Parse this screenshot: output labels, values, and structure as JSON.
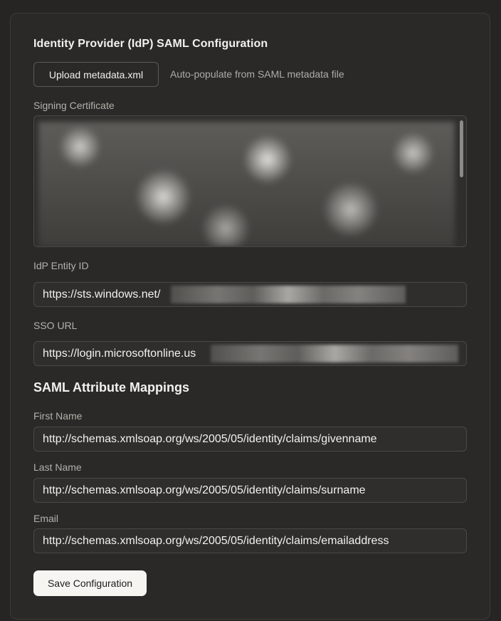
{
  "idp": {
    "title": "Identity Provider (IdP) SAML Configuration",
    "upload_label": "Upload metadata.xml",
    "upload_hint": "Auto-populate from SAML metadata file",
    "cert_label": "Signing Certificate",
    "entity_label": "IdP Entity ID",
    "entity_value": "https://sts.windows.net/",
    "sso_label": "SSO URL",
    "sso_value": "https://login.microsoftonline.us"
  },
  "mappings": {
    "title": "SAML Attribute Mappings",
    "first_name_label": "First Name",
    "first_name_value": "http://schemas.xmlsoap.org/ws/2005/05/identity/claims/givenname",
    "last_name_label": "Last Name",
    "last_name_value": "http://schemas.xmlsoap.org/ws/2005/05/identity/claims/surname",
    "email_label": "Email",
    "email_value": "http://schemas.xmlsoap.org/ws/2005/05/identity/claims/emailaddress"
  },
  "actions": {
    "save_label": "Save Configuration"
  }
}
